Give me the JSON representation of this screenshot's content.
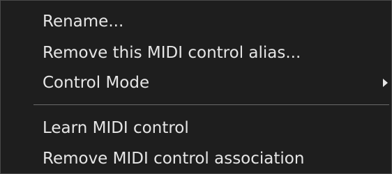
{
  "context_menu": {
    "items": [
      {
        "label": "Rename..."
      },
      {
        "label": "Remove this MIDI control alias..."
      },
      {
        "label": "Control Mode",
        "submenu_icon": "chevron-right-icon"
      },
      {
        "label": "Learn MIDI control"
      },
      {
        "label": "Remove MIDI control association"
      }
    ]
  },
  "colors": {
    "background": "#1e1e1e",
    "text": "#e6e6e6",
    "separator": "#6a6a6a"
  }
}
